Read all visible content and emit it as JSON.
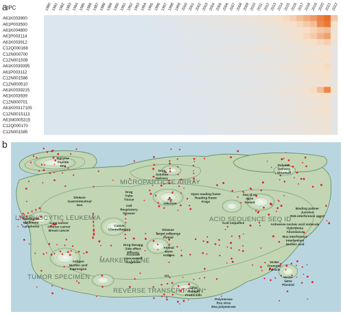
{
  "panel_a_label": "a",
  "panel_b_label": "b",
  "chart_data": [
    {
      "type": "heatmap",
      "row_header": "IPC",
      "years": [
        "1980",
        "1981",
        "1982",
        "1983",
        "1984",
        "1985",
        "1986",
        "1987",
        "1988",
        "1989",
        "1990",
        "1991",
        "1992",
        "1993",
        "1994",
        "1995",
        "1996",
        "1997",
        "1998",
        "1999",
        "2000",
        "2001",
        "2002",
        "2003",
        "2004",
        "2005",
        "2006",
        "2007",
        "2008",
        "2009",
        "2010",
        "2011",
        "2012",
        "2013",
        "2014",
        "2015",
        "2016",
        "2017",
        "2018",
        "2019",
        "2020",
        "2021",
        "2022"
      ],
      "rows": [
        "A61K003900",
        "A61P003500",
        "A61K004800",
        "A61P003114",
        "A61K003912",
        "C12Q000168",
        "C12N000700",
        "C12N001509",
        "A61K0039395",
        "A61P003112",
        "C12N001586",
        "C12N000510",
        "A61K0039215",
        "A61K003939",
        "C12N000701",
        "A61K00317105",
        "C12N0015113",
        "A61M0005315",
        "C12Q000170",
        "C12N001585"
      ],
      "low_color": "#dce6ef",
      "high_color": "#e8702a",
      "values": [
        [
          0,
          0,
          0,
          0,
          0,
          0,
          0,
          0,
          0,
          0,
          0,
          0,
          0,
          0,
          0,
          0,
          0.03,
          0.04,
          0.05,
          0.07,
          0.1,
          0.11,
          0.12,
          0.12,
          0.13,
          0.14,
          0.15,
          0.16,
          0.17,
          0.18,
          0.2,
          0.22,
          0.25,
          0.28,
          0.32,
          0.38,
          0.45,
          0.55,
          0.65,
          0.75,
          0.9,
          1.0,
          0.5
        ],
        [
          0,
          0,
          0,
          0,
          0,
          0,
          0,
          0,
          0,
          0,
          0,
          0,
          0,
          0,
          0,
          0,
          0.02,
          0.03,
          0.04,
          0.05,
          0.07,
          0.08,
          0.08,
          0.09,
          0.1,
          0.1,
          0.11,
          0.12,
          0.12,
          0.13,
          0.14,
          0.16,
          0.18,
          0.2,
          0.23,
          0.28,
          0.33,
          0.4,
          0.48,
          0.55,
          0.85,
          0.95,
          0.35
        ],
        [
          0,
          0,
          0,
          0,
          0,
          0,
          0,
          0,
          0,
          0,
          0,
          0,
          0,
          0,
          0,
          0,
          0.02,
          0.02,
          0.03,
          0.04,
          0.05,
          0.06,
          0.06,
          0.07,
          0.08,
          0.08,
          0.09,
          0.1,
          0.1,
          0.11,
          0.12,
          0.13,
          0.15,
          0.17,
          0.19,
          0.22,
          0.26,
          0.3,
          0.36,
          0.42,
          0.5,
          0.55,
          0.25
        ],
        [
          0,
          0,
          0,
          0,
          0,
          0,
          0,
          0,
          0,
          0,
          0,
          0,
          0,
          0,
          0,
          0,
          0.01,
          0.02,
          0.02,
          0.03,
          0.04,
          0.05,
          0.05,
          0.06,
          0.06,
          0.07,
          0.08,
          0.08,
          0.09,
          0.1,
          0.1,
          0.12,
          0.14,
          0.16,
          0.18,
          0.22,
          0.27,
          0.33,
          0.4,
          0.48,
          0.62,
          0.72,
          0.3
        ],
        [
          0,
          0,
          0,
          0,
          0,
          0,
          0,
          0,
          0,
          0,
          0,
          0,
          0,
          0,
          0,
          0,
          0.01,
          0.02,
          0.02,
          0.03,
          0.04,
          0.04,
          0.05,
          0.05,
          0.06,
          0.06,
          0.07,
          0.07,
          0.08,
          0.08,
          0.09,
          0.1,
          0.11,
          0.13,
          0.15,
          0.18,
          0.22,
          0.26,
          0.3,
          0.34,
          0.4,
          0.45,
          0.2
        ],
        [
          0,
          0,
          0,
          0,
          0,
          0,
          0,
          0,
          0,
          0,
          0,
          0,
          0,
          0,
          0,
          0,
          0,
          0.01,
          0.02,
          0.03,
          0.05,
          0.06,
          0.07,
          0.08,
          0.09,
          0.1,
          0.11,
          0.12,
          0.13,
          0.14,
          0.15,
          0.16,
          0.25,
          0.2,
          0.17,
          0.16,
          0.18,
          0.2,
          0.22,
          0.24,
          0.26,
          0.28,
          0.12
        ],
        [
          0,
          0,
          0,
          0,
          0,
          0,
          0,
          0,
          0,
          0,
          0,
          0,
          0,
          0,
          0,
          0,
          0,
          0.01,
          0.02,
          0.02,
          0.03,
          0.04,
          0.05,
          0.06,
          0.07,
          0.07,
          0.08,
          0.09,
          0.1,
          0.11,
          0.12,
          0.12,
          0.14,
          0.15,
          0.16,
          0.18,
          0.2,
          0.22,
          0.25,
          0.28,
          0.32,
          0.34,
          0.15
        ],
        [
          0,
          0,
          0,
          0,
          0,
          0,
          0,
          0,
          0,
          0,
          0,
          0,
          0,
          0,
          0,
          0,
          0,
          0.01,
          0.01,
          0.02,
          0.03,
          0.03,
          0.04,
          0.05,
          0.05,
          0.06,
          0.07,
          0.07,
          0.08,
          0.09,
          0.1,
          0.1,
          0.12,
          0.13,
          0.14,
          0.16,
          0.18,
          0.2,
          0.22,
          0.25,
          0.28,
          0.3,
          0.12
        ],
        [
          0,
          0,
          0,
          0,
          0,
          0,
          0,
          0,
          0,
          0,
          0,
          0,
          0,
          0,
          0,
          0,
          0.01,
          0.02,
          0.03,
          0.04,
          0.05,
          0.06,
          0.07,
          0.07,
          0.08,
          0.09,
          0.1,
          0.1,
          0.11,
          0.12,
          0.13,
          0.14,
          0.15,
          0.16,
          0.18,
          0.2,
          0.22,
          0.25,
          0.28,
          0.31,
          0.35,
          0.38,
          0.15
        ],
        [
          0,
          0,
          0,
          0,
          0,
          0,
          0,
          0,
          0,
          0,
          0,
          0,
          0,
          0,
          0,
          0,
          0.01,
          0.01,
          0.02,
          0.03,
          0.04,
          0.04,
          0.05,
          0.06,
          0.06,
          0.07,
          0.08,
          0.08,
          0.09,
          0.1,
          0.1,
          0.11,
          0.12,
          0.14,
          0.15,
          0.17,
          0.2,
          0.22,
          0.25,
          0.28,
          0.32,
          0.35,
          0.14
        ],
        [
          0,
          0,
          0,
          0,
          0,
          0,
          0,
          0,
          0,
          0,
          0,
          0,
          0,
          0,
          0,
          0,
          0,
          0,
          0.01,
          0.02,
          0.02,
          0.03,
          0.04,
          0.04,
          0.05,
          0.06,
          0.06,
          0.07,
          0.08,
          0.08,
          0.09,
          0.1,
          0.11,
          0.12,
          0.13,
          0.15,
          0.17,
          0.19,
          0.22,
          0.24,
          0.27,
          0.3,
          0.12
        ],
        [
          0,
          0,
          0,
          0,
          0,
          0,
          0,
          0,
          0,
          0,
          0,
          0,
          0,
          0,
          0,
          0,
          0,
          0.01,
          0.01,
          0.02,
          0.03,
          0.03,
          0.04,
          0.05,
          0.05,
          0.06,
          0.07,
          0.07,
          0.08,
          0.09,
          0.09,
          0.1,
          0.11,
          0.12,
          0.14,
          0.15,
          0.17,
          0.19,
          0.21,
          0.23,
          0.26,
          0.28,
          0.11
        ],
        [
          0,
          0,
          0,
          0,
          0,
          0,
          0,
          0,
          0,
          0,
          0,
          0,
          0,
          0,
          0,
          0,
          0.01,
          0.02,
          0.03,
          0.04,
          0.05,
          0.05,
          0.06,
          0.07,
          0.07,
          0.08,
          0.09,
          0.09,
          0.1,
          0.11,
          0.12,
          0.12,
          0.14,
          0.15,
          0.17,
          0.19,
          0.22,
          0.25,
          0.3,
          0.38,
          0.55,
          0.85,
          0.3
        ],
        [
          0,
          0,
          0,
          0,
          0,
          0,
          0,
          0,
          0,
          0,
          0,
          0,
          0,
          0,
          0,
          0,
          0,
          0.01,
          0.02,
          0.02,
          0.03,
          0.04,
          0.05,
          0.05,
          0.06,
          0.07,
          0.07,
          0.08,
          0.09,
          0.09,
          0.1,
          0.11,
          0.12,
          0.13,
          0.14,
          0.16,
          0.18,
          0.2,
          0.23,
          0.26,
          0.3,
          0.33,
          0.13
        ],
        [
          0,
          0,
          0,
          0,
          0,
          0,
          0,
          0,
          0,
          0,
          0,
          0,
          0,
          0,
          0,
          0,
          0,
          0,
          0.01,
          0.01,
          0.02,
          0.03,
          0.03,
          0.04,
          0.05,
          0.05,
          0.06,
          0.07,
          0.07,
          0.08,
          0.09,
          0.09,
          0.1,
          0.11,
          0.12,
          0.14,
          0.15,
          0.17,
          0.19,
          0.21,
          0.24,
          0.26,
          0.1
        ],
        [
          0,
          0,
          0,
          0,
          0,
          0,
          0,
          0,
          0,
          0,
          0,
          0,
          0,
          0,
          0,
          0,
          0,
          0,
          0.01,
          0.02,
          0.02,
          0.03,
          0.04,
          0.04,
          0.05,
          0.06,
          0.06,
          0.07,
          0.08,
          0.08,
          0.09,
          0.1,
          0.11,
          0.12,
          0.13,
          0.15,
          0.17,
          0.19,
          0.21,
          0.24,
          0.27,
          0.29,
          0.11
        ],
        [
          0,
          0,
          0,
          0,
          0,
          0,
          0,
          0,
          0,
          0,
          0,
          0,
          0,
          0,
          0,
          0,
          0,
          0,
          0,
          0.01,
          0.02,
          0.02,
          0.03,
          0.04,
          0.04,
          0.05,
          0.06,
          0.07,
          0.08,
          0.09,
          0.1,
          0.11,
          0.12,
          0.13,
          0.15,
          0.16,
          0.18,
          0.2,
          0.22,
          0.24,
          0.26,
          0.28,
          0.1
        ],
        [
          0,
          0,
          0,
          0,
          0,
          0,
          0,
          0,
          0,
          0,
          0,
          0,
          0,
          0,
          0,
          0,
          0,
          0,
          0.01,
          0.01,
          0.02,
          0.02,
          0.03,
          0.03,
          0.04,
          0.05,
          0.05,
          0.06,
          0.06,
          0.07,
          0.08,
          0.08,
          0.09,
          0.1,
          0.11,
          0.12,
          0.14,
          0.16,
          0.18,
          0.2,
          0.22,
          0.25,
          0.1
        ],
        [
          0,
          0,
          0,
          0,
          0,
          0,
          0,
          0,
          0,
          0,
          0,
          0,
          0,
          0,
          0,
          0,
          0,
          0.01,
          0.02,
          0.02,
          0.03,
          0.04,
          0.04,
          0.05,
          0.06,
          0.06,
          0.07,
          0.08,
          0.08,
          0.09,
          0.1,
          0.11,
          0.12,
          0.13,
          0.14,
          0.15,
          0.16,
          0.17,
          0.19,
          0.2,
          0.22,
          0.24,
          0.1
        ],
        [
          0,
          0,
          0,
          0,
          0,
          0,
          0,
          0,
          0,
          0,
          0,
          0,
          0,
          0,
          0,
          0,
          0,
          0,
          0.01,
          0.02,
          0.02,
          0.03,
          0.03,
          0.04,
          0.05,
          0.05,
          0.06,
          0.07,
          0.07,
          0.08,
          0.09,
          0.09,
          0.1,
          0.11,
          0.12,
          0.13,
          0.15,
          0.16,
          0.18,
          0.2,
          0.22,
          0.24,
          0.1
        ]
      ]
    }
  ],
  "term_map": {
    "colors": {
      "water": "#b9d6e0",
      "land": "#c2d6b4",
      "contour": "#4f7a55",
      "dot": "#d9232e"
    },
    "clusters": [
      "LYMPHOCYTIC LEUKEMIA",
      "MICROPARTICLE ARRAY",
      "ACID SEQUENCE SEQ ID",
      "MARKER GENE",
      "TUMOR SPECIMEN",
      "REVERSE TRANSCRIPTION"
    ],
    "terms": [
      "Enzyme",
      "Peptide",
      "Dna",
      "Drug",
      "Solution",
      "Delivery",
      "Polymer",
      "Delivery",
      "Structure",
      "Disease",
      "Gastrointestinal",
      "Gen",
      "Drug",
      "Palm",
      "Tissue",
      "Cell",
      "Respiratory",
      "Disease",
      "Hiv",
      "Infection",
      "Open reading frame",
      "Reading frame",
      "Frags",
      "Seq id no",
      "Id no",
      "Variant",
      "Binding partner",
      "Junction",
      "Rna interference agent",
      "Lung cancer",
      "Ovarian cancer",
      "Breast cancer",
      "Carcinoma",
      "Melanoma",
      "Lymphoma",
      "Cancer",
      "Chemotherapy",
      "Disease",
      "Target sequence",
      "Animal",
      "Acid sequence",
      "Antisense nucleic acid molecule",
      "Hybridoma",
      "Abundance",
      "Rna interference",
      "Interference",
      "Nucleic acid",
      "Drug therapy",
      "Side effect",
      "Efficacy",
      "Accurate",
      "Liver cancer",
      "Diagnosis",
      "Animal",
      "Gene",
      "Antigen",
      "Antigen",
      "Nucleic acid",
      "Expression",
      "Vector",
      "Promoter",
      "Particle",
      "Vector",
      "Gene",
      "Plasmid",
      "Kit",
      "Cdna",
      "Plasmid",
      "Production",
      "Polymerase",
      "Rna virus",
      "Rna polymerase"
    ]
  }
}
